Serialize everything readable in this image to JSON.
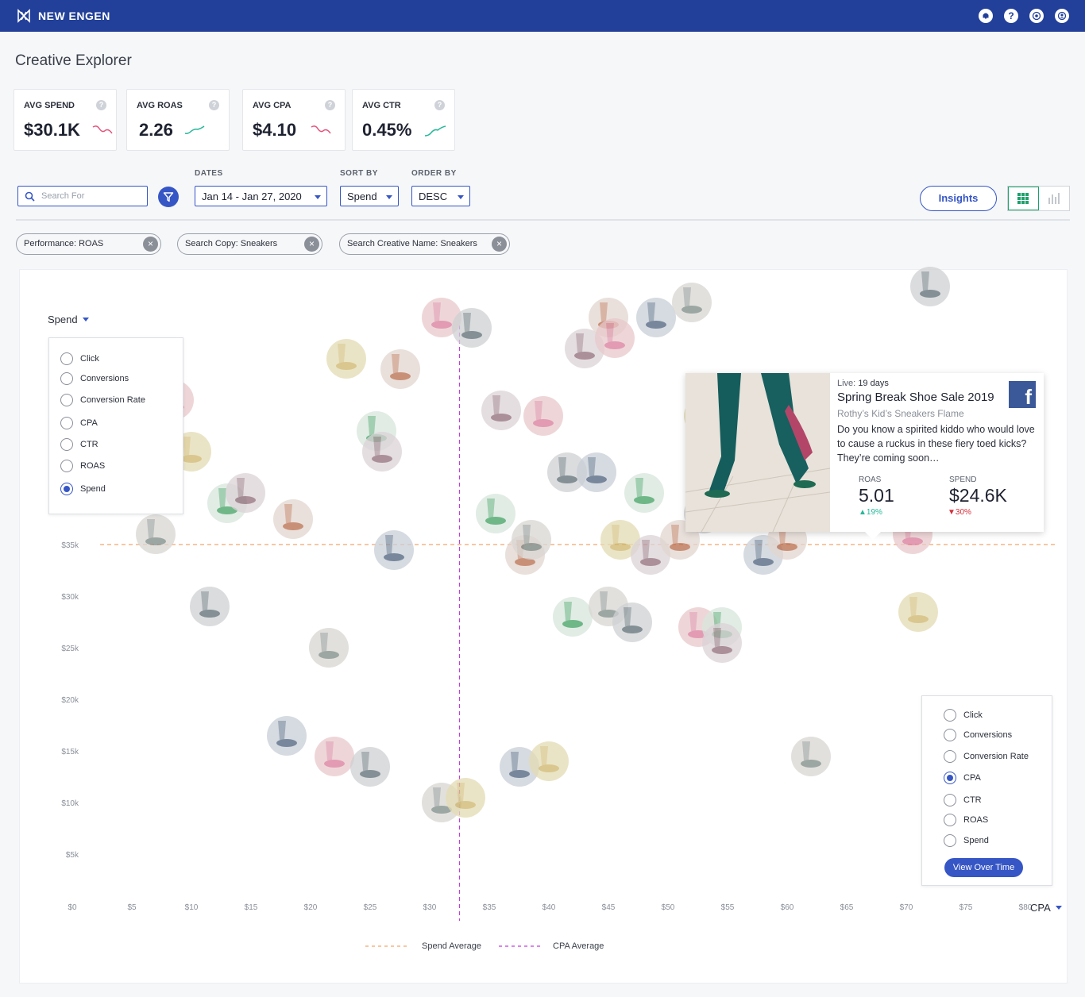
{
  "header": {
    "brand": "NEW ENGEN",
    "icons": [
      "bell-icon",
      "help-icon",
      "target-icon",
      "profile-icon"
    ]
  },
  "page": {
    "title": "Creative Explorer"
  },
  "kpis": [
    {
      "label": "AVG SPEND",
      "value": "$30.1K",
      "trend": "down",
      "color": "#e5517a"
    },
    {
      "label": "AVG ROAS",
      "value": "2.26",
      "trend": "up",
      "color": "#27b898"
    },
    {
      "label": "AVG CPA",
      "value": "$4.10",
      "trend": "down",
      "color": "#e5517a"
    },
    {
      "label": "AVG CTR",
      "value": "0.45%",
      "trend": "up",
      "color": "#27b898"
    }
  ],
  "controls": {
    "search_placeholder": "Search For",
    "dates_label": "DATES",
    "dates_value": "Jan 14 - Jan 27, 2020",
    "sort_label": "SORT BY",
    "sort_value": "Spend",
    "order_label": "ORDER BY",
    "order_value": "DESC",
    "insights_label": "Insights"
  },
  "filters": [
    "Performance: ROAS",
    "Search Copy: Sneakers",
    "Search Creative Name: Sneakers"
  ],
  "metric_options": [
    "Click",
    "Conversions",
    "Conversion Rate",
    "CPA",
    "CTR",
    "ROAS",
    "Spend"
  ],
  "y_axis": {
    "selected": "Spend"
  },
  "x_axis": {
    "selected": "CPA",
    "button": "View Over Time"
  },
  "chart_data": {
    "type": "scatter",
    "x_metric": "CPA",
    "y_metric": "Spend",
    "x_ticks": [
      "$0",
      "$5",
      "$10",
      "$15",
      "$20",
      "$25",
      "$30",
      "$35",
      "$40",
      "$45",
      "$50",
      "$55",
      "$60",
      "$65",
      "$70",
      "$75",
      "$80"
    ],
    "y_ticks": [
      "$5k",
      "$10k",
      "$15k",
      "$20k",
      "$25k",
      "$30k",
      "$35k"
    ],
    "spend_average": 35,
    "cpa_average": 32.5,
    "legend": [
      "Spend Average",
      "CPA Average"
    ],
    "points": [
      [
        7,
        36
      ],
      [
        8.5,
        49
      ],
      [
        10,
        44
      ],
      [
        11.5,
        29
      ],
      [
        13,
        39
      ],
      [
        14.5,
        40
      ],
      [
        18,
        16.5
      ],
      [
        18.5,
        37.5
      ],
      [
        21.5,
        25
      ],
      [
        22,
        14.5
      ],
      [
        23,
        53
      ],
      [
        25,
        13.5
      ],
      [
        25.5,
        46
      ],
      [
        26,
        44
      ],
      [
        27,
        34.5
      ],
      [
        27.5,
        52
      ],
      [
        31,
        10
      ],
      [
        31,
        57
      ],
      [
        33,
        10.5
      ],
      [
        33.5,
        56
      ],
      [
        35.5,
        38
      ],
      [
        36,
        48
      ],
      [
        37.5,
        13.5
      ],
      [
        38,
        34
      ],
      [
        38.5,
        35.5
      ],
      [
        39.5,
        47.5
      ],
      [
        40,
        14
      ],
      [
        41.5,
        42
      ],
      [
        42,
        28
      ],
      [
        43,
        54
      ],
      [
        44,
        42
      ],
      [
        45,
        57
      ],
      [
        45,
        29
      ],
      [
        45.5,
        55
      ],
      [
        46,
        35.5
      ],
      [
        47,
        27.5
      ],
      [
        48,
        40
      ],
      [
        48.5,
        34
      ],
      [
        49,
        57
      ],
      [
        51,
        35.5
      ],
      [
        52,
        58.5
      ],
      [
        52.5,
        27
      ],
      [
        53,
        47.5
      ],
      [
        53,
        38
      ],
      [
        54.5,
        27
      ],
      [
        54.5,
        25.5
      ],
      [
        58,
        34
      ],
      [
        60,
        35.5
      ],
      [
        62,
        14.5
      ],
      [
        70.5,
        36
      ],
      [
        71,
        28.5
      ],
      [
        72,
        60
      ]
    ],
    "tooltip": {
      "live_prefix": "Live:",
      "live_value": "19 days",
      "title": "Spring Break Shoe Sale 2019",
      "subtitle": "Rothy’s Kid’s Sneakers Flame",
      "body": "Do you know a spirited kiddo who would love to cause a ruckus in these fiery toed kicks? They’re coming soon…",
      "roas_label": "ROAS",
      "roas_value": "5.01",
      "roas_change": "19%",
      "spend_label": "SPEND",
      "spend_value": "$24.6K",
      "spend_change": "30%"
    }
  },
  "colors": {
    "header": "#22409a",
    "accent": "#3656c6",
    "spend_avg": "#f5a56b",
    "cpa_avg": "#c33ce0",
    "positive": "#27b898",
    "negative": "#e5517a"
  }
}
